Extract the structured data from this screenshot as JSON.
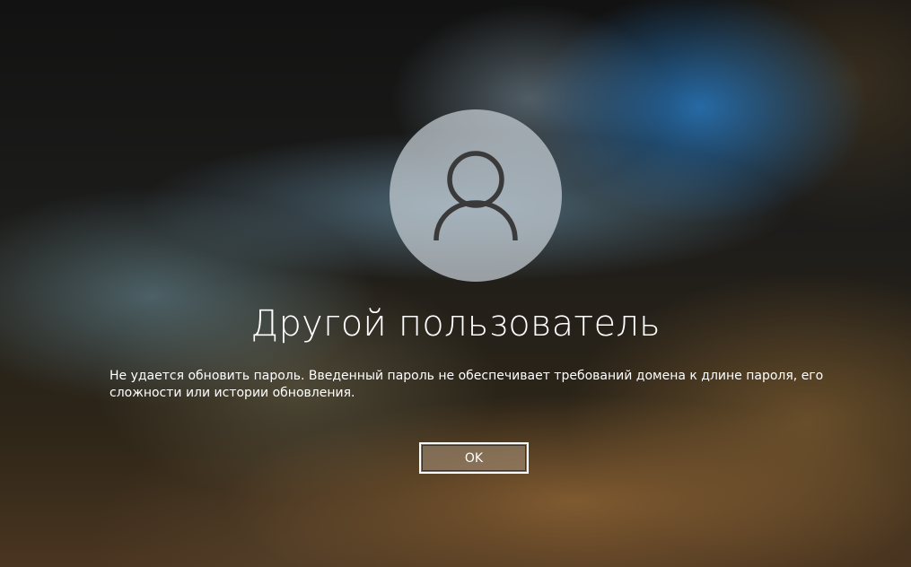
{
  "user": {
    "name": "Другой пользователь",
    "avatar_icon": "user-silhouette-icon"
  },
  "dialog": {
    "message": "Не удается обновить пароль. Введенный пароль не обеспечивает требований домена к длине пароля, его сложности или истории обновления.",
    "ok_label": "OK"
  },
  "colors": {
    "text": "#ffffff",
    "avatar_bg": "#c8d0d7",
    "icon_stroke": "#3a3a3a",
    "button_border": "#ffffff"
  }
}
